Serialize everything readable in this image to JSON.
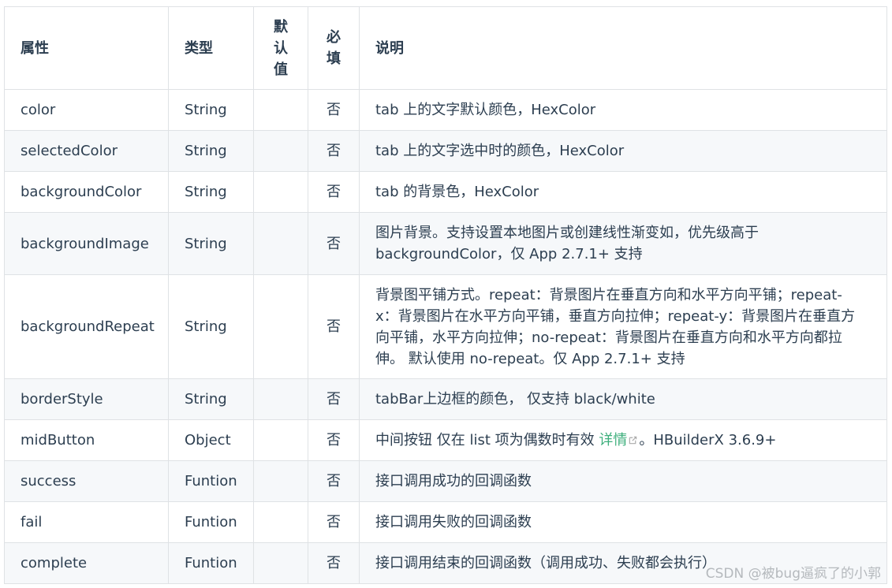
{
  "table": {
    "headers": {
      "property": "属性",
      "type": "类型",
      "default": "默\n认\n值",
      "required": "必\n填",
      "description": "说明"
    },
    "rows": [
      {
        "property": "color",
        "type": "String",
        "default": "",
        "required": "否",
        "description": "tab 上的文字默认颜色，HexColor"
      },
      {
        "property": "selectedColor",
        "type": "String",
        "default": "",
        "required": "否",
        "description": "tab 上的文字选中时的颜色，HexColor"
      },
      {
        "property": "backgroundColor",
        "type": "String",
        "default": "",
        "required": "否",
        "description": "tab 的背景色，HexColor"
      },
      {
        "property": "backgroundImage",
        "type": "String",
        "default": "",
        "required": "否",
        "description": "图片背景。支持设置本地图片或创建线性渐变如，优先级高于 backgroundColor，仅 App 2.7.1+ 支持"
      },
      {
        "property": "backgroundRepeat",
        "type": "String",
        "default": "",
        "required": "否",
        "description": "背景图平铺方式。repeat：背景图片在垂直方向和水平方向平铺；repeat-x：背景图片在水平方向平铺，垂直方向拉伸；repeat-y：背景图片在垂直方向平铺，水平方向拉伸；no-repeat：背景图片在垂直方向和水平方向都拉伸。 默认使用 no-repeat。仅 App 2.7.1+ 支持"
      },
      {
        "property": "borderStyle",
        "type": "String",
        "default": "",
        "required": "否",
        "description": "tabBar上边框的颜色， 仅支持 black/white"
      },
      {
        "property": "midButton",
        "type": "Object",
        "default": "",
        "required": "否",
        "description_before": "中间按钮 仅在 list 项为偶数时有效 ",
        "description_link": "详情",
        "description_after": "。HBuilderX 3.6.9+"
      },
      {
        "property": "success",
        "type": "Funtion",
        "default": "",
        "required": "否",
        "description": "接口调用成功的回调函数"
      },
      {
        "property": "fail",
        "type": "Funtion",
        "default": "",
        "required": "否",
        "description": "接口调用失败的回调函数"
      },
      {
        "property": "complete",
        "type": "Funtion",
        "default": "",
        "required": "否",
        "description": "接口调用结束的回调函数（调用成功、失败都会执行）"
      }
    ]
  },
  "watermark": "CSDN @被bug逼疯了的小郭",
  "colors": {
    "border": "#dfe2e5",
    "stripe": "#f6f8fa",
    "text": "#2c3e50",
    "link": "#3eaf7c"
  }
}
